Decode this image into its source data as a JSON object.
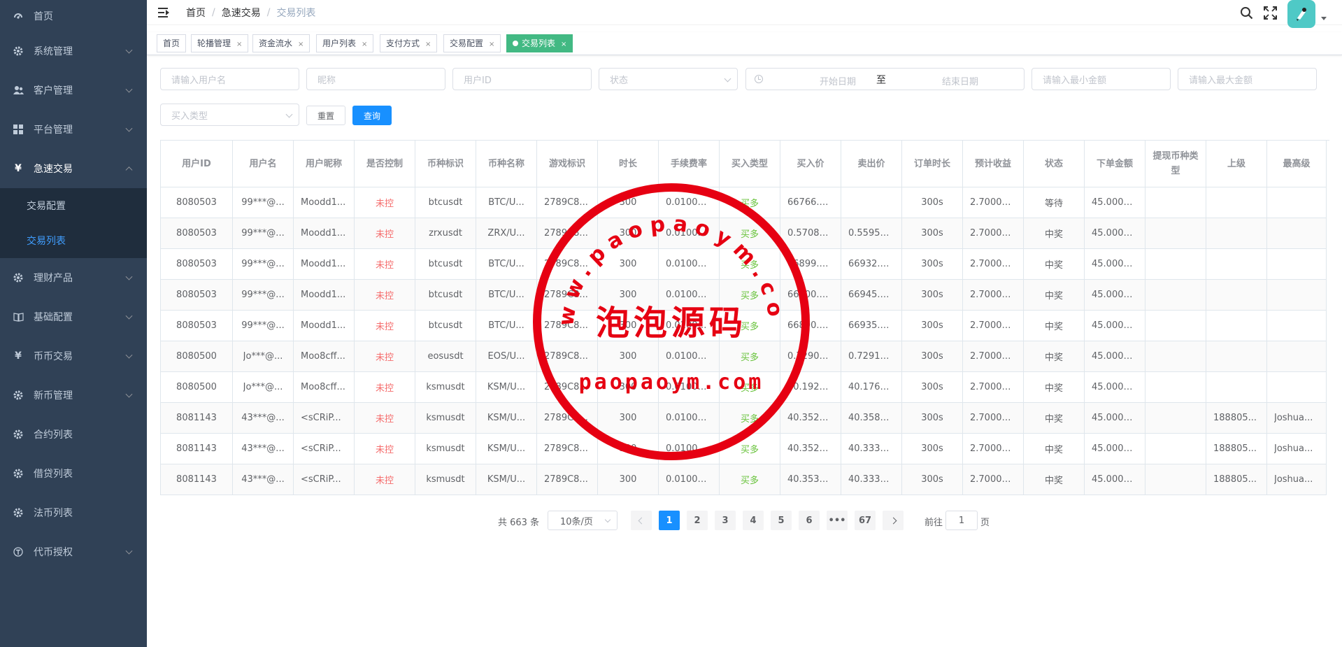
{
  "sidebar": {
    "items": [
      {
        "label": "首页",
        "icon": "dashboard-icon",
        "chevron": false
      },
      {
        "label": "系统管理",
        "icon": "gear-icon",
        "chevron": true
      },
      {
        "label": "客户管理",
        "icon": "users-icon",
        "chevron": true
      },
      {
        "label": "平台管理",
        "icon": "grid-icon",
        "chevron": true
      },
      {
        "label": "急速交易",
        "icon": "yen-icon",
        "chevron": true,
        "expanded": true
      },
      {
        "label": "理财产品",
        "icon": "gear-icon",
        "chevron": true
      },
      {
        "label": "基础配置",
        "icon": "book-icon",
        "chevron": true
      },
      {
        "label": "币币交易",
        "icon": "yen-icon",
        "chevron": true
      },
      {
        "label": "新币管理",
        "icon": "gear-icon",
        "chevron": true
      },
      {
        "label": "合约列表",
        "icon": "gear-icon",
        "chevron": false
      },
      {
        "label": "借贷列表",
        "icon": "gear-icon",
        "chevron": false
      },
      {
        "label": "法币列表",
        "icon": "gear-icon",
        "chevron": false
      },
      {
        "label": "代币授权",
        "icon": "token-icon",
        "chevron": true
      }
    ],
    "submenu": [
      {
        "label": "交易配置"
      },
      {
        "label": "交易列表",
        "active": true
      }
    ]
  },
  "breadcrumb": [
    "首页",
    "急速交易",
    "交易列表"
  ],
  "tags": [
    {
      "label": "首页",
      "closable": false
    },
    {
      "label": "轮播管理",
      "closable": true
    },
    {
      "label": "资金流水",
      "closable": true
    },
    {
      "label": "用户列表",
      "closable": true
    },
    {
      "label": "支付方式",
      "closable": true
    },
    {
      "label": "交易配置",
      "closable": true
    },
    {
      "label": "交易列表",
      "closable": true,
      "active": true
    }
  ],
  "filters": {
    "username_placeholder": "请输入用户名",
    "nickname_placeholder": "昵称",
    "userid_placeholder": "用户ID",
    "status_placeholder": "状态",
    "start_date_placeholder": "开始日期",
    "date_separator": "至",
    "end_date_placeholder": "结束日期",
    "min_amount_placeholder": "请输入最小金额",
    "max_amount_placeholder": "请输入最大金额",
    "buy_type_placeholder": "买入类型",
    "reset_label": "重置",
    "search_label": "查询"
  },
  "table": {
    "headers": [
      "用户ID",
      "用户名",
      "用户昵称",
      "是否控制",
      "币种标识",
      "币种名称",
      "游戏标识",
      "时长",
      "手续费率",
      "买入类型",
      "买入价",
      "卖出价",
      "订单时长",
      "预计收益",
      "状态",
      "下单金额",
      "提现币种类型",
      "上级",
      "最高级"
    ],
    "rows": [
      [
        "8080503",
        "99***@...",
        "Moodd1...",
        "未控",
        "btcusdt",
        "BTC/U...",
        "2789C8...",
        "300",
        "0.01000...",
        "买多",
        "66766.5...",
        "",
        "300s",
        "2.70000...",
        "等待",
        "45.0000...",
        "",
        "",
        ""
      ],
      [
        "8080503",
        "99***@...",
        "Moodd1...",
        "未控",
        "zrxusdt",
        "ZRX/U...",
        "2789C8...",
        "300",
        "0.01000...",
        "买多",
        "0.57080...",
        "0.55950...",
        "300s",
        "2.70000...",
        "中奖",
        "45.0000...",
        "",
        "",
        ""
      ],
      [
        "8080503",
        "99***@...",
        "Moodd1...",
        "未控",
        "btcusdt",
        "BTC/U...",
        "2789C8...",
        "300",
        "0.01000...",
        "买多",
        "66899.9...",
        "66932.9...",
        "300s",
        "2.70000...",
        "中奖",
        "45.0000...",
        "",
        "",
        ""
      ],
      [
        "8080503",
        "99***@...",
        "Moodd1...",
        "未控",
        "btcusdt",
        "BTC/U...",
        "2789C8...",
        "300",
        "0.01000...",
        "买多",
        "66900.0...",
        "66945.3...",
        "300s",
        "2.70000...",
        "中奖",
        "45.0000...",
        "",
        "",
        ""
      ],
      [
        "8080503",
        "99***@...",
        "Moodd1...",
        "未控",
        "btcusdt",
        "BTC/U...",
        "2789C8...",
        "300",
        "0.01000...",
        "买多",
        "66890.0...",
        "66935.2...",
        "300s",
        "2.70000...",
        "中奖",
        "45.0000...",
        "",
        "",
        ""
      ],
      [
        "8080500",
        "Jo***@...",
        "Moo8cff...",
        "未控",
        "eosusdt",
        "EOS/U...",
        "2789C8...",
        "300",
        "0.01000...",
        "买多",
        "0.72900...",
        "0.72910...",
        "300s",
        "2.70000...",
        "中奖",
        "45.0000...",
        "",
        "",
        ""
      ],
      [
        "8080500",
        "Jo***@...",
        "Moo8cff...",
        "未控",
        "ksmusdt",
        "KSM/U...",
        "2789C8...",
        "300",
        "0.01000...",
        "买多",
        "40.1925...",
        "40.1762...",
        "300s",
        "2.70000...",
        "中奖",
        "45.0000...",
        "",
        "",
        ""
      ],
      [
        "8081143",
        "43***@...",
        "<sCRiP...",
        "未控",
        "ksmusdt",
        "KSM/U...",
        "2789C8...",
        "300",
        "0.01000...",
        "买多",
        "40.3527...",
        "40.3581...",
        "300s",
        "2.70000...",
        "中奖",
        "45.0000...",
        "",
        "188805...",
        "Joshua..."
      ],
      [
        "8081143",
        "43***@...",
        "<sCRiP...",
        "未控",
        "ksmusdt",
        "KSM/U...",
        "2789C8...",
        "300",
        "0.01000...",
        "买多",
        "40.3525...",
        "40.3333...",
        "300s",
        "2.70000...",
        "中奖",
        "45.0000...",
        "",
        "188805...",
        "Joshua..."
      ],
      [
        "8081143",
        "43***@...",
        "<sCRiP...",
        "未控",
        "ksmusdt",
        "KSM/U...",
        "2789C8...",
        "300",
        "0.01000...",
        "买多",
        "40.3533...",
        "40.3335...",
        "300s",
        "2.70000...",
        "中奖",
        "45.0000...",
        "",
        "188805...",
        "Joshua..."
      ]
    ]
  },
  "pagination": {
    "total_text": "共 663 条",
    "page_size": "10条/页",
    "pages": [
      "1",
      "2",
      "3",
      "4",
      "5",
      "6",
      "•••",
      "67"
    ],
    "current_page": "1",
    "goto_label": "前往",
    "goto_value": "1",
    "page_suffix": "页"
  },
  "watermark": {
    "url_arc": "www.paopaoym.com",
    "chinese": "泡泡源码",
    "domain": "paopaoym.com"
  },
  "colors": {
    "sidebar_bg": "#304156",
    "submenu_bg": "#1f2d3d",
    "active_link": "#409eff",
    "primary": "#1890ff",
    "tag_active": "#42b983",
    "red_text": "#f56c6c",
    "green_text": "#67c23a",
    "stamp_red": "#e60012",
    "avatar_bg": "#4fc9c6"
  }
}
